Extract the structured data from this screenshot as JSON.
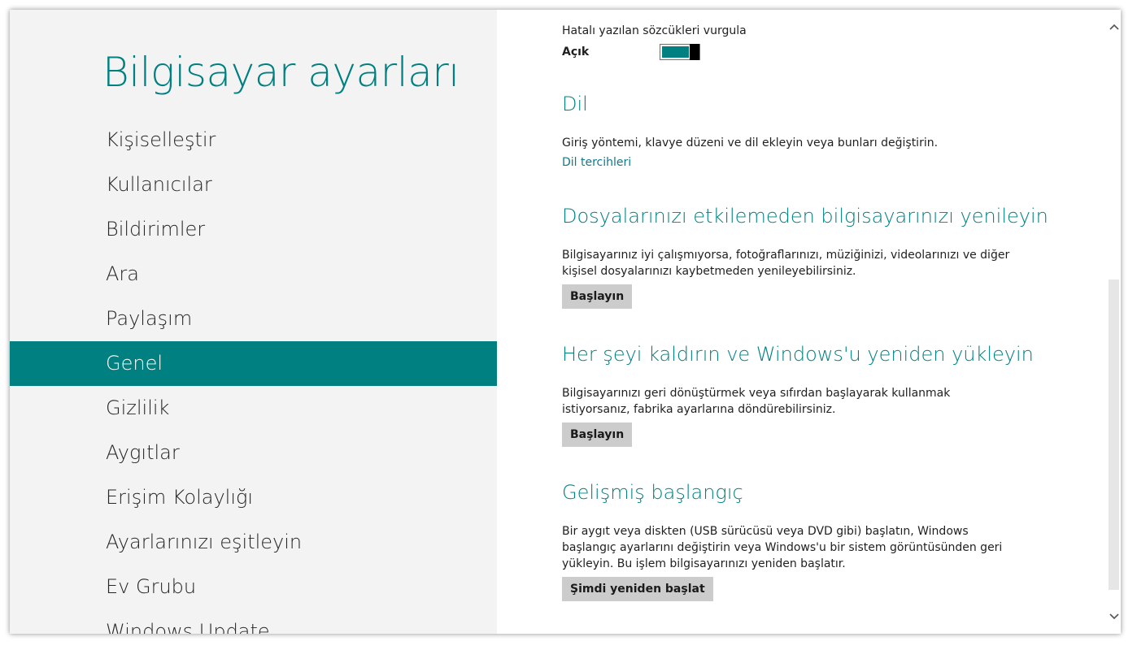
{
  "app": {
    "title": "Bilgisayar ayarları"
  },
  "nav": {
    "items": [
      {
        "label": "Kişiselleştir"
      },
      {
        "label": "Kullanıcılar"
      },
      {
        "label": "Bildirimler"
      },
      {
        "label": "Ara"
      },
      {
        "label": "Paylaşım"
      },
      {
        "label": "Genel"
      },
      {
        "label": "Gizlilik"
      },
      {
        "label": "Aygıtlar"
      },
      {
        "label": "Erişim Kolaylığı"
      },
      {
        "label": "Ayarlarınızı eşitleyin"
      },
      {
        "label": "Ev Grubu"
      },
      {
        "label": "Windows Update"
      }
    ],
    "active": "Genel"
  },
  "spelling": {
    "label": "Hatalı yazılan sözcükleri vurgula",
    "state": "Açık",
    "on": true
  },
  "language": {
    "title": "Dil",
    "description": "Giriş yöntemi, klavye düzeni ve dil ekleyin veya bunları değiştirin.",
    "link": "Dil tercihleri"
  },
  "refresh": {
    "title": "Dosyalarınızı etkilemeden bilgisayarınızı yenileyin",
    "description": "Bilgisayarınız iyi çalışmıyorsa, fotoğraflarınızı, müziğinizi, videolarınızı ve diğer kişisel dosyalarınızı kaybetmeden yenileyebilirsiniz.",
    "button": "Başlayın"
  },
  "reset": {
    "title": "Her şeyi kaldırın ve Windows'u yeniden yükleyin",
    "description": "Bilgisayarınızı geri dönüştürmek veya sıfırdan başlayarak kullanmak istiyorsanız, fabrika ayarlarına döndürebilirsiniz.",
    "button": "Başlayın"
  },
  "advanced": {
    "title": "Gelişmiş başlangıç",
    "description": "Bir aygıt veya diskten (USB sürücüsü veya DVD gibi) başlatın, Windows başlangıç ayarlarını değiştirin veya Windows'u bir sistem görüntüsünden geri yükleyin. Bu işlem bilgisayarınızı yeniden başlatır.",
    "button": "Şimdi yeniden başlat"
  },
  "colors": {
    "accent": "#008080",
    "pane": "#f3f3f3",
    "button": "#cccccc"
  }
}
